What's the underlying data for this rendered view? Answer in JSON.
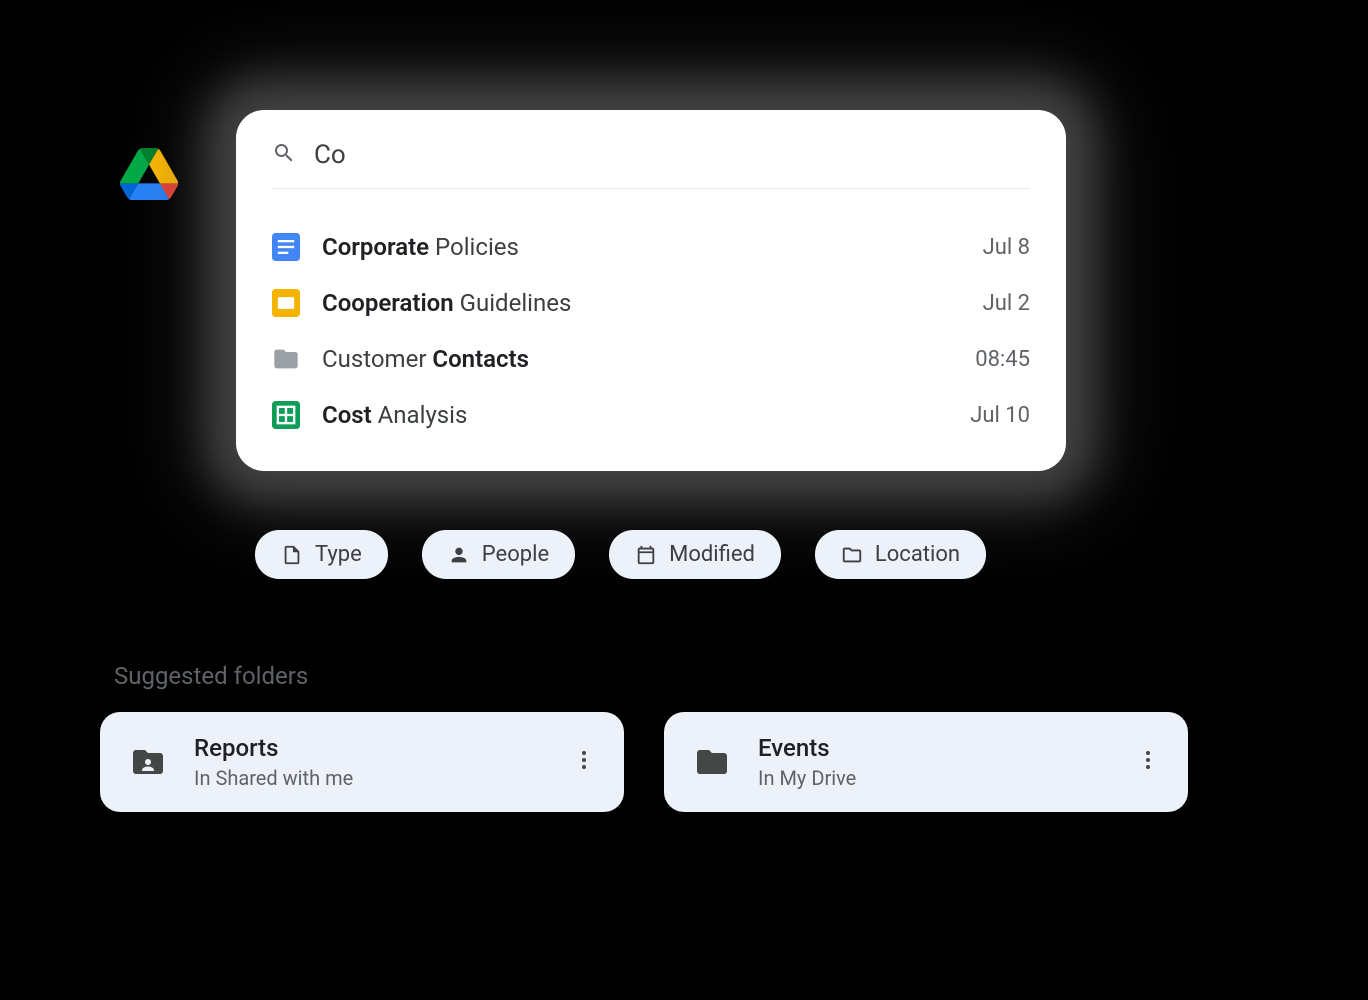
{
  "search": {
    "query": "Co"
  },
  "results": [
    {
      "bold": "Corporate",
      "rest": " Policies",
      "date": "Jul 8",
      "icon": "docs"
    },
    {
      "bold": "Cooperation",
      "rest": " Guidelines",
      "date": "Jul 2",
      "icon": "slides"
    },
    {
      "prefix": "Customer ",
      "bold": "Contacts",
      "date": "08:45",
      "icon": "folder"
    },
    {
      "bold": "Cost",
      "rest": " Analysis",
      "date": "Jul 10",
      "icon": "sheets"
    }
  ],
  "chips": {
    "type": "Type",
    "people": "People",
    "modified": "Modified",
    "location": "Location"
  },
  "suggested": {
    "title": "Suggested folders",
    "folders": [
      {
        "name": "Reports",
        "location": "In Shared with me",
        "icon": "shared-folder"
      },
      {
        "name": "Events",
        "location": "In My Drive",
        "icon": "folder"
      }
    ]
  }
}
